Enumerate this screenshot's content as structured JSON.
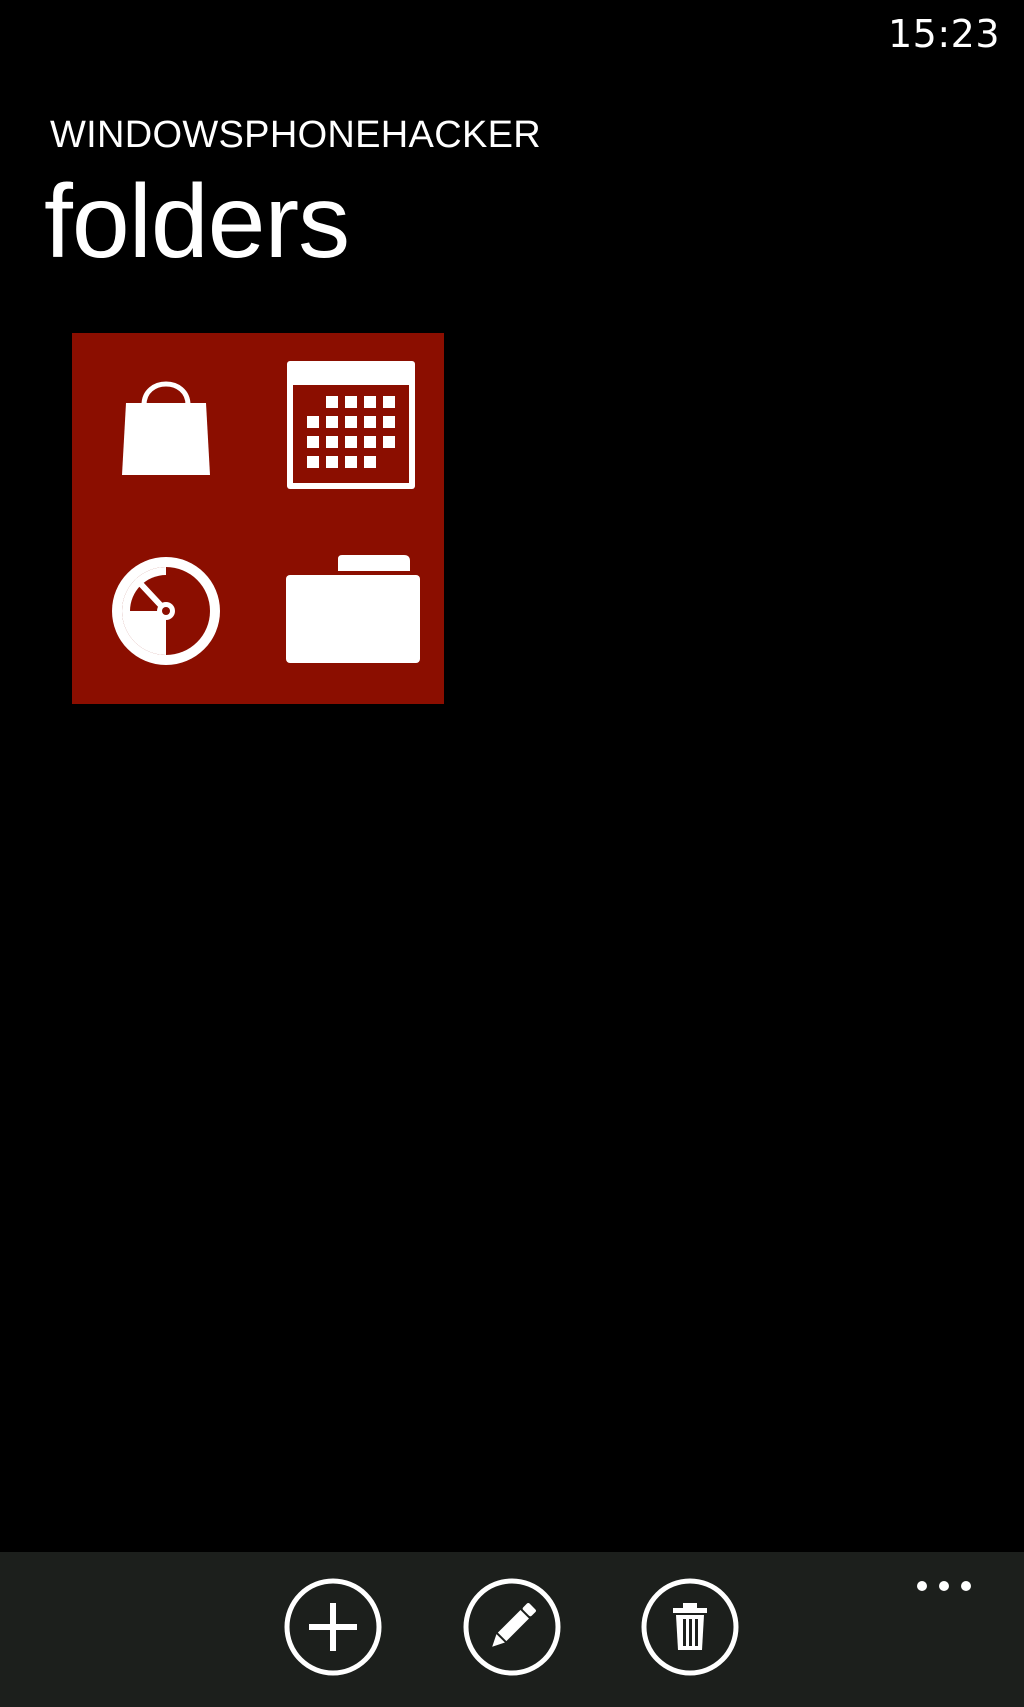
{
  "status": {
    "time": "15:23"
  },
  "header": {
    "app_title": "WINDOWSPHONEHACKER",
    "page_title": "folders"
  },
  "tile": {
    "color": "#8b0e00",
    "icons": [
      "shopping-bag-icon",
      "calendar-icon",
      "speedometer-icon",
      "folder-icon"
    ]
  },
  "app_bar": {
    "background": "#1c1f1c",
    "buttons": [
      "add-icon",
      "edit-pencil-icon",
      "delete-trash-icon"
    ],
    "more": "ellipsis-icon"
  }
}
